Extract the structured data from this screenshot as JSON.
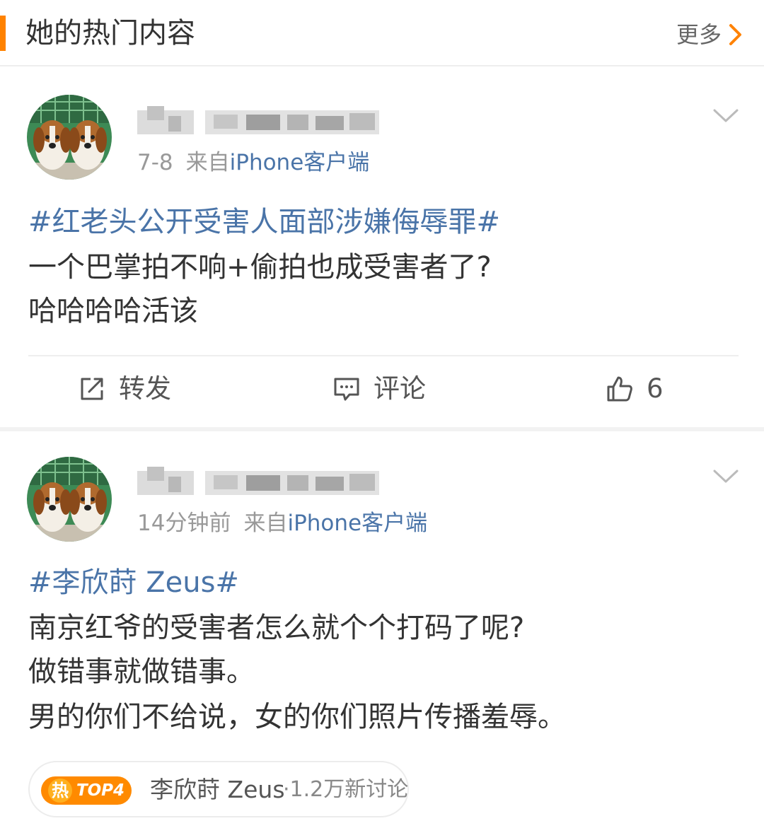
{
  "header": {
    "title": "她的热门内容",
    "more_label": "更多",
    "more_icon": "chevron-right-icon",
    "accent_color": "#ff8200"
  },
  "posts": [
    {
      "avatar_icon": "beagle-puppies-avatar",
      "time": "7-8",
      "source_prefix": "来自",
      "source": "iPhone客户端",
      "topic": "#红老头公开受害人面部涉嫌侮辱罪#",
      "lines": [
        "一个巴掌拍不响+偷拍也成受害者了?",
        "哈哈哈哈活该"
      ],
      "actions": {
        "repost_label": "转发",
        "comment_label": "评论",
        "like_count": "6"
      }
    },
    {
      "avatar_icon": "beagle-puppies-avatar",
      "time": "14分钟前",
      "source_prefix": "来自",
      "source": "iPhone客户端",
      "topic": "#李欣莳 Zeus#",
      "lines": [
        "南京红爷的受害者怎么就个个打码了呢?",
        "做错事就做错事。",
        "男的你们不给说，女的你们照片传播羞辱。"
      ],
      "trend": {
        "hot_char": "热",
        "rank": "TOP4",
        "name": "李欣莳 Zeus",
        "count": "·1.2万新讨论"
      }
    }
  ],
  "colors": {
    "link": "#4a74a8",
    "hot_badge": "#ff8a00",
    "muted": "#999999"
  }
}
